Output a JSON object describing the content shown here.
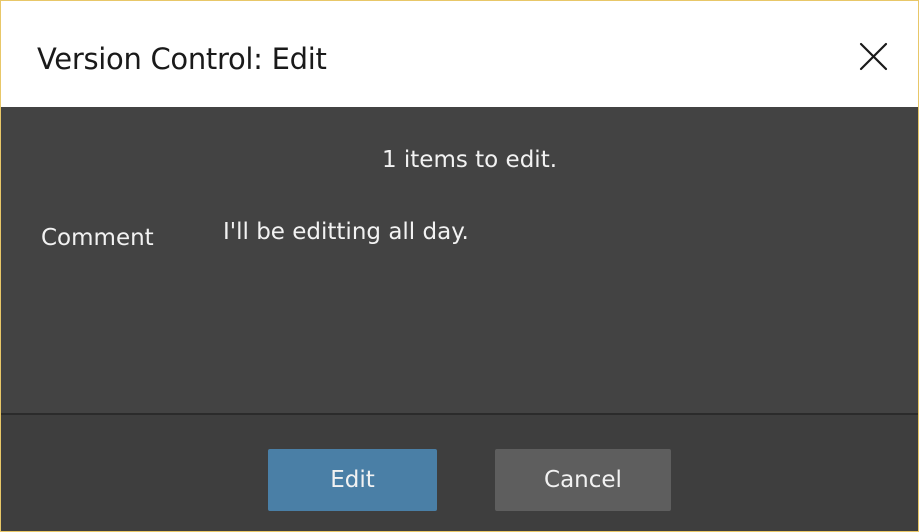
{
  "window": {
    "title": "Version Control: Edit",
    "close_icon": "close-icon"
  },
  "content": {
    "items_count_text": "1 items to edit.",
    "comment_label": "Comment",
    "comment_value": "I'll be editting all day."
  },
  "footer": {
    "edit_label": "Edit",
    "cancel_label": "Cancel"
  },
  "colors": {
    "window_border": "#e8c768",
    "titlebar_bg": "#ffffff",
    "body_bg": "#434343",
    "footer_bg": "#3e3e3e",
    "primary_button": "#4a7fa6",
    "secondary_button": "#5e5e5e",
    "text_light": "#f2f2f2"
  }
}
